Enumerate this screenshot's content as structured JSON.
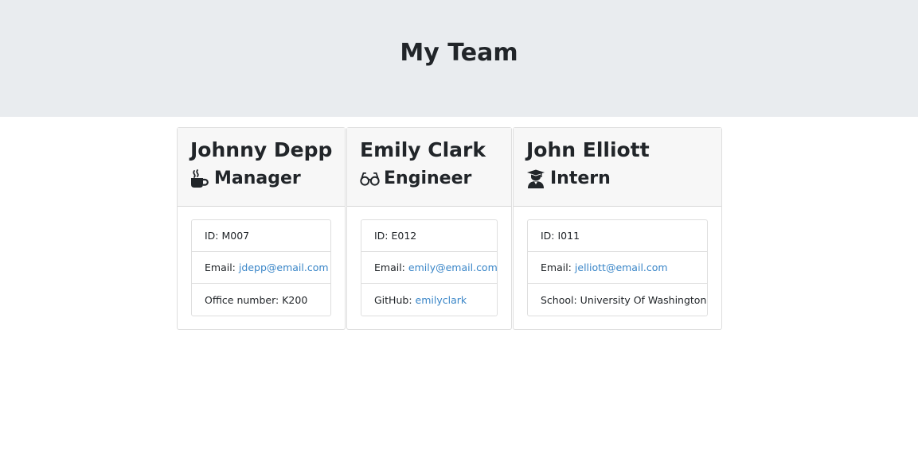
{
  "header": {
    "title": "My Team"
  },
  "team": [
    {
      "name": "Johnny Depp",
      "role": "Manager",
      "role_icon": "mug-icon",
      "id_label": "ID: M007",
      "email_label": "Email:",
      "email": "jdepp@email.com",
      "extra_label": "Office number: K200",
      "extra_link": ""
    },
    {
      "name": "Emily Clark",
      "role": "Engineer",
      "role_icon": "glasses-icon",
      "id_label": "ID: E012",
      "email_label": "Email:",
      "email": "emily@email.com",
      "extra_label": "GitHub:",
      "extra_link": "emilyclark"
    },
    {
      "name": "John Elliott",
      "role": "Intern",
      "role_icon": "graduate-icon",
      "id_label": "ID: I011",
      "email_label": "Email:",
      "email": "jelliott@email.com",
      "extra_label": "School: University Of Washington",
      "extra_link": ""
    }
  ],
  "colors": {
    "header_bg": "#e9ecef",
    "card_header_bg": "#f7f7f7",
    "link": "#3a86c8",
    "text": "#212529"
  }
}
